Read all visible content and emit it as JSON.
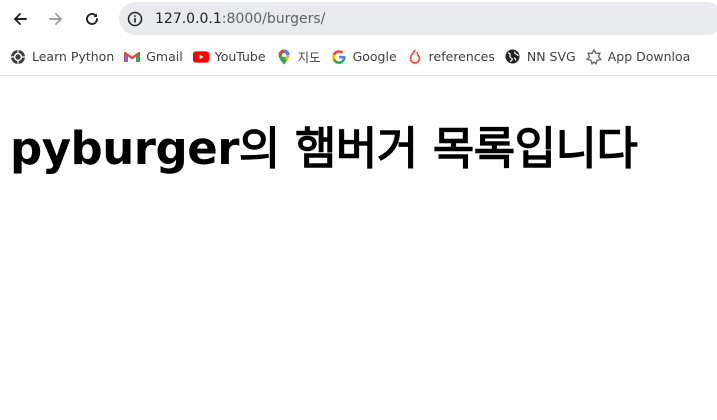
{
  "browser": {
    "url_host": "127.0.0.1",
    "url_rest": ":8000/burgers/",
    "bookmarks": [
      {
        "label": "Learn Python",
        "icon": "python-icon"
      },
      {
        "label": "Gmail",
        "icon": "gmail-icon"
      },
      {
        "label": "YouTube",
        "icon": "youtube-icon"
      },
      {
        "label": "지도",
        "icon": "maps-pin-icon"
      },
      {
        "label": "Google",
        "icon": "google-icon"
      },
      {
        "label": "references",
        "icon": "references-icon"
      },
      {
        "label": "NN SVG",
        "icon": "globe-icon"
      },
      {
        "label": "App Downloa",
        "icon": "app-download-icon"
      }
    ]
  },
  "page": {
    "heading": "pyburger의 햄버거 목록입니다"
  },
  "colors": {
    "omnibox_bg": "#e8eaed",
    "text": "#202124",
    "youtube_red": "#ff0000",
    "gmail_red": "#ea4335"
  }
}
